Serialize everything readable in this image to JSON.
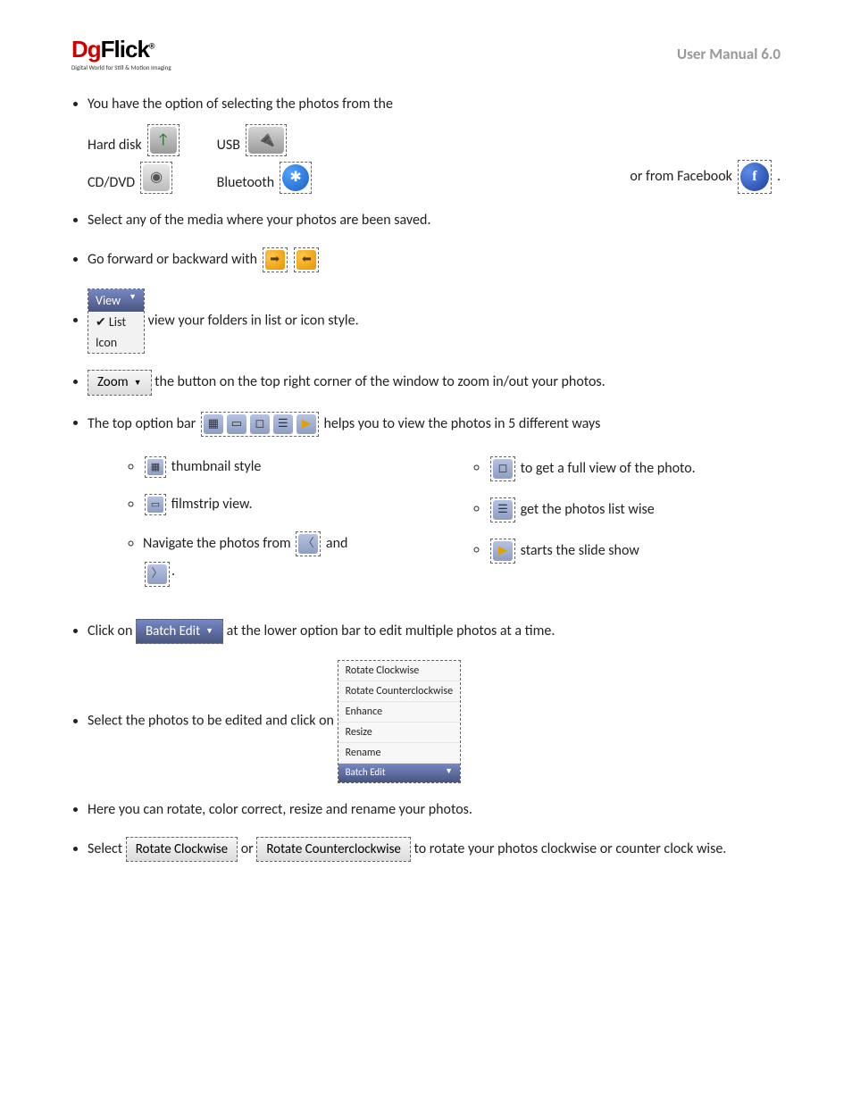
{
  "logo": {
    "left": "Dg",
    "right": "Flick",
    "sub": "Digital World for Still & Motion Imaging"
  },
  "header": {
    "title": "User Manual 6.0"
  },
  "b1": {
    "intro": "You have the option of selecting the photos from the",
    "hard_disk": "Hard disk",
    "cd_dvd": "CD/DVD",
    "usb": "USB",
    "bluetooth": "Bluetooth",
    "or_fb": "or from Facebook"
  },
  "b2": "Select any of the media where your photos are been saved.",
  "b3": "Go forward or backward with",
  "view_menu": {
    "head": "View",
    "list": "List",
    "icon": "Icon"
  },
  "b4_tail": "view your folders in list or icon style.",
  "zoom_label": "Zoom",
  "b5_a": "the button on the top right corner of the window to zoom in/out your photos.",
  "b6_a": "The top option bar",
  "b6_b": "helps you to view the photos in 5 different ways",
  "sL1": "thumbnail style",
  "sL2": "filmstrip view.",
  "sL3a": "Navigate the photos from",
  "sL3b": "and",
  "sR1": "to get a full view of the photo.",
  "sR2": "get the photos list wise",
  "sR3": "starts the slide show",
  "b7_a": "Click on",
  "batch_edit_label": "Batch Edit",
  "b7_b": "at the lower option bar to edit multiple photos at a time.",
  "b8_a": "Select the photos to be edited and click on",
  "batch_menu": {
    "i1": "Rotate Clockwise",
    "i2": "Rotate Counterclockwise",
    "i3": "Enhance",
    "i4": "Resize",
    "i5": "Rename",
    "foot": "Batch Edit"
  },
  "b9": "Here you can rotate, color correct, resize and rename your photos.",
  "b10_a": "Select",
  "rot_cw": "Rotate Clockwise",
  "b10_b": "or",
  "rot_ccw": "Rotate Counterclockwise",
  "b10_c": "to rotate your photos clockwise or counter clock wise."
}
